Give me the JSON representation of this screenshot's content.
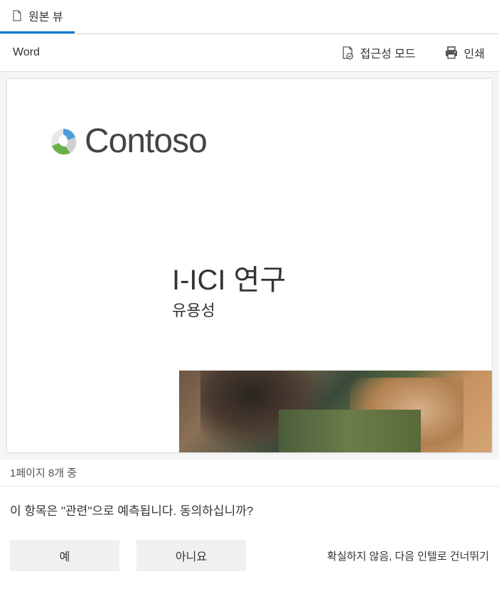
{
  "tabs": {
    "original_view": "원본 뷰"
  },
  "toolbar": {
    "app_label": "Word",
    "accessibility_mode": "접근성 모드",
    "print": "인쇄"
  },
  "document": {
    "company": "Contoso",
    "title": "I-ICI  연구",
    "subtitle": "유용성"
  },
  "status": {
    "page_info": "1페이지  8개 중"
  },
  "feedback": {
    "question": "이 항목은 \"관련\"으로 예측됩니다. 동의하십니까?",
    "yes": "예",
    "no": "아니요",
    "skip": "확실하지 않음, 다음 인텔로 건너뛰기"
  }
}
